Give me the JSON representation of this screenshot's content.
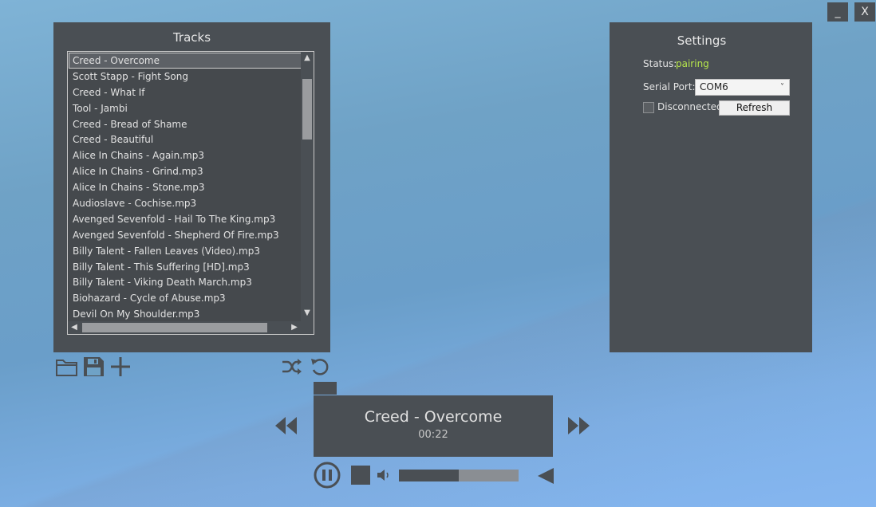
{
  "window": {
    "minimize_label": "_",
    "close_label": "X"
  },
  "tracks": {
    "title": "Tracks",
    "selected_index": 0,
    "items": [
      "Creed - Overcome",
      "Scott Stapp - Fight Song",
      "Creed - What If",
      "Tool - Jambi",
      "Creed - Bread of Shame",
      "Creed - Beautiful",
      "Alice In Chains - Again.mp3",
      "Alice In Chains - Grind.mp3",
      "Alice In Chains - Stone.mp3",
      "Audioslave - Cochise.mp3",
      "Avenged Sevenfold - Hail To The King.mp3",
      "Avenged Sevenfold - Shepherd Of Fire.mp3",
      "Billy Talent - Fallen Leaves (Video).mp3",
      "Billy Talent - This Suffering [HD].mp3",
      "Billy Talent - Viking Death March.mp3",
      "Biohazard - Cycle of Abuse.mp3",
      "Devil On My Shoulder.mp3"
    ]
  },
  "icons": {
    "open": "folder-icon",
    "save": "save-icon",
    "add": "plus-icon",
    "shuffle": "shuffle-icon",
    "repeat": "repeat-icon",
    "prev": "previous-icon",
    "next": "next-icon",
    "pause": "pause-icon",
    "stop": "stop-icon",
    "volume": "speaker-icon",
    "collapse": "triangle-left-icon"
  },
  "settings": {
    "title": "Settings",
    "status_label": "Status:",
    "status_value": "pairing",
    "serial_port_label": "Serial Port:",
    "serial_port_value": "COM6",
    "connection_label": "Disconnected",
    "refresh_label": "Refresh"
  },
  "player": {
    "title": "Creed - Overcome",
    "time": "00:22",
    "volume_fraction": 0.5
  },
  "colors": {
    "panel": "#4a4f54",
    "status_accent": "#b7e64b",
    "icon": "#4a4f54"
  }
}
